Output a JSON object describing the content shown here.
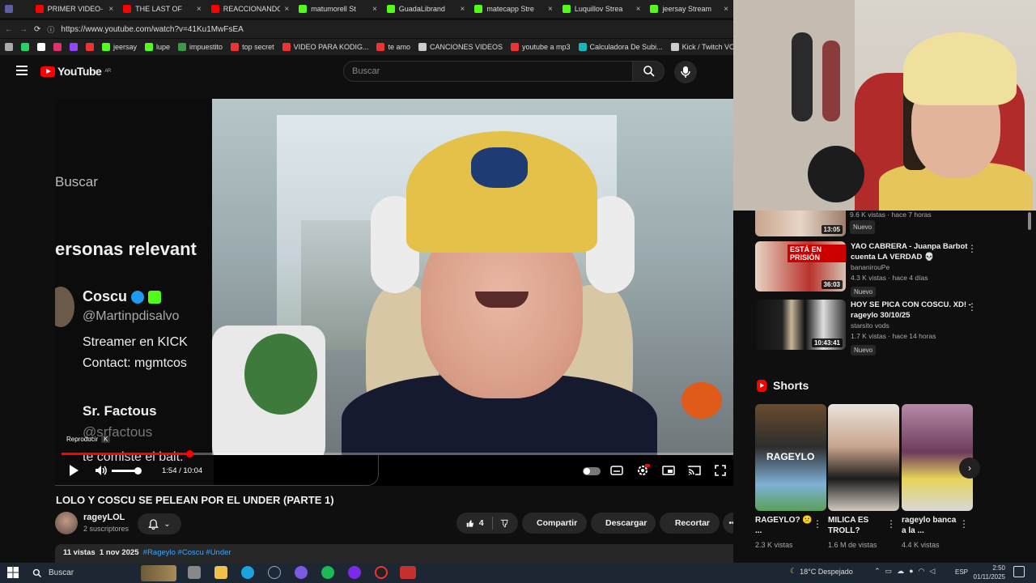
{
  "browser": {
    "tabs": [
      {
        "label": "",
        "color": "#5b5ea6"
      },
      {
        "label": "PRIMER VIDEO- vid",
        "color": "#ff0000"
      },
      {
        "label": "THE LAST OF",
        "color": "#ff0000"
      },
      {
        "label": "REACCIONANDO a",
        "color": "#ff0000"
      },
      {
        "label": "matumorell St",
        "color": "#53fc18"
      },
      {
        "label": "GuadaLibrand",
        "color": "#53fc18"
      },
      {
        "label": "matecapp Stre",
        "color": "#53fc18"
      },
      {
        "label": "Luquillov Strea",
        "color": "#53fc18"
      },
      {
        "label": "jeersay Stream",
        "color": "#53fc18"
      }
    ],
    "url": "https://www.youtube.com/watch?v=41Ku1MwFsEA",
    "bookmarks": [
      "jeersay",
      "lupe",
      "impuestito",
      "top secret",
      "VIDEO PARA KODIG...",
      "te amo",
      "CANCIONES VIDEOS",
      "youtube a mp3",
      "Calculadora De Subi...",
      "Kick / Twitch VOD"
    ]
  },
  "youtube": {
    "logo": "YouTube",
    "region": "AR",
    "search_placeholder": "Buscar"
  },
  "video": {
    "overlay": {
      "search": "Buscar",
      "relevant": "ersonas relevant",
      "name1": "Coscu",
      "handle1": "@Martinpdisalvo",
      "bio1": "Streamer en KICK",
      "bio2": "Contact: mgmtcos",
      "name2": "Sr. Factous",
      "handle2": "@srfactous",
      "bait": "te comiste el bait."
    },
    "tooltip": "Reproducir",
    "tooltip_key": "K",
    "time": "1:54 / 10:04",
    "progress": 0.189
  },
  "info": {
    "title": "LOLO Y COSCU SE PELEAN POR EL UNDER (PARTE 1)",
    "channel": "rageyLOL",
    "subscribers": "2 suscriptores",
    "likes": "4",
    "share": "Compartir",
    "download": "Descargar",
    "clip": "Recortar",
    "views": "11 vistas",
    "date": "1 nov 2025",
    "tags": "#Rageylo #Coscu #Under"
  },
  "sidebar": {
    "partial": {
      "stats": "9.6 K vistas · hace 7 horas",
      "duration": "13:05",
      "badge": "Nuevo"
    },
    "videos": [
      {
        "title": "YAO CABRERA - Juanpa Barbot cuenta LA VERDAD 💀",
        "channel": "bananirouPe",
        "stats": "4.3 K vistas · hace 4 días",
        "duration": "36:03",
        "badge": "Nuevo",
        "thumb_text": "ESTÁ EN PRISIÓN"
      },
      {
        "title": "HOY SE PICA CON COSCU. XD! - rageylo 30/10/25",
        "channel": "starsito vods",
        "stats": "1.7 K vistas · hace 14 horas",
        "duration": "10:43:41",
        "badge": "Nuevo"
      }
    ],
    "shorts_title": "Shorts",
    "shorts": [
      {
        "title": "RAGEYLO? 😕 ...",
        "views": "2.3 K vistas",
        "thumb_text": "RAGEYLO"
      },
      {
        "title": "MILICA ES TROLL?",
        "views": "1.6 M de vistas"
      },
      {
        "title": "rageylo banca a la ...",
        "views": "4.4 K vistas"
      }
    ]
  },
  "taskbar": {
    "search": "Buscar",
    "weather": "18°C  Despejado",
    "lang": "ESP",
    "time": "2:50",
    "date": "01/11/2025"
  }
}
